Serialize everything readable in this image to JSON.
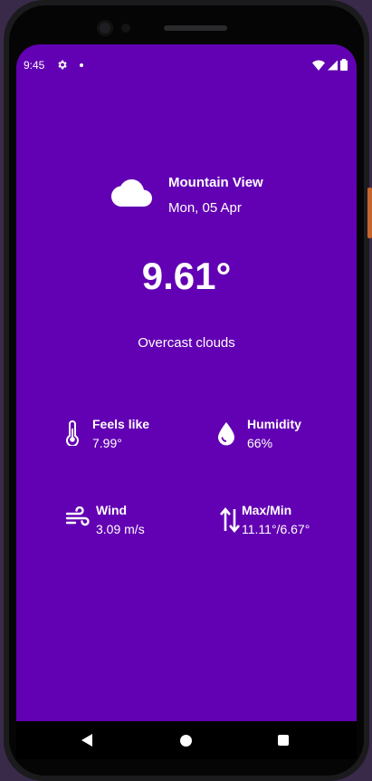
{
  "status_bar": {
    "time": "9:45",
    "icons": [
      "gear-icon",
      "notification-dot-icon",
      "wifi-icon",
      "signal-icon",
      "battery-icon"
    ]
  },
  "weather": {
    "city": "Mountain View",
    "date": "Mon, 05 Apr",
    "temperature": "9.61°",
    "description": "Overcast clouds",
    "condition_icon": "cloud-icon"
  },
  "stats": {
    "feels_like": {
      "label": "Feels like",
      "value": "7.99°",
      "icon": "thermometer-icon"
    },
    "humidity": {
      "label": "Humidity",
      "value": "66%",
      "icon": "water-drop-icon"
    },
    "wind": {
      "label": "Wind",
      "value": "3.09 m/s",
      "icon": "wind-icon"
    },
    "max_min": {
      "label": "Max/Min",
      "value": "11.11°/6.67°",
      "icon": "swap-vertical-icon"
    }
  },
  "nav_bar": {
    "buttons": [
      "back-icon",
      "home-icon",
      "recents-icon"
    ]
  },
  "colors": {
    "background": "#6200b3",
    "text": "#ffffff"
  }
}
